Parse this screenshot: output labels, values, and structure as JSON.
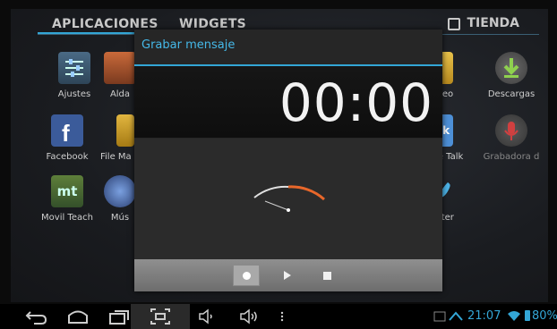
{
  "launcher": {
    "tabs": {
      "apps": "APLICACIONES",
      "widgets": "WIDGETS",
      "store": "TIENDA"
    },
    "apps_row1": [
      "Ajustes",
      "Alda",
      "rreo",
      "Descargas"
    ],
    "apps_row2": [
      "Facebook",
      "File Ma",
      "le Talk",
      "Grabadora d"
    ],
    "apps_row3": [
      "Movil Teach",
      "Mús",
      "itter"
    ]
  },
  "dialog": {
    "title": "Grabar mensaje",
    "timer": "00:00",
    "controls": [
      "record",
      "play",
      "stop"
    ]
  },
  "statusbar": {
    "time": "21:07",
    "battery": "80%"
  },
  "colors": {
    "accent": "#33a6d6",
    "meter_orange": "#e8672a"
  },
  "icons": [
    "settings-icon",
    "facebook-icon",
    "folder-icon",
    "downloads-icon",
    "talk-icon",
    "mic-icon",
    "twitter-icon",
    "back-icon",
    "home-icon",
    "recents-icon",
    "screenshot-icon",
    "volume-down-icon",
    "volume-up-icon",
    "menu-icon",
    "wifi-icon",
    "battery-icon"
  ]
}
